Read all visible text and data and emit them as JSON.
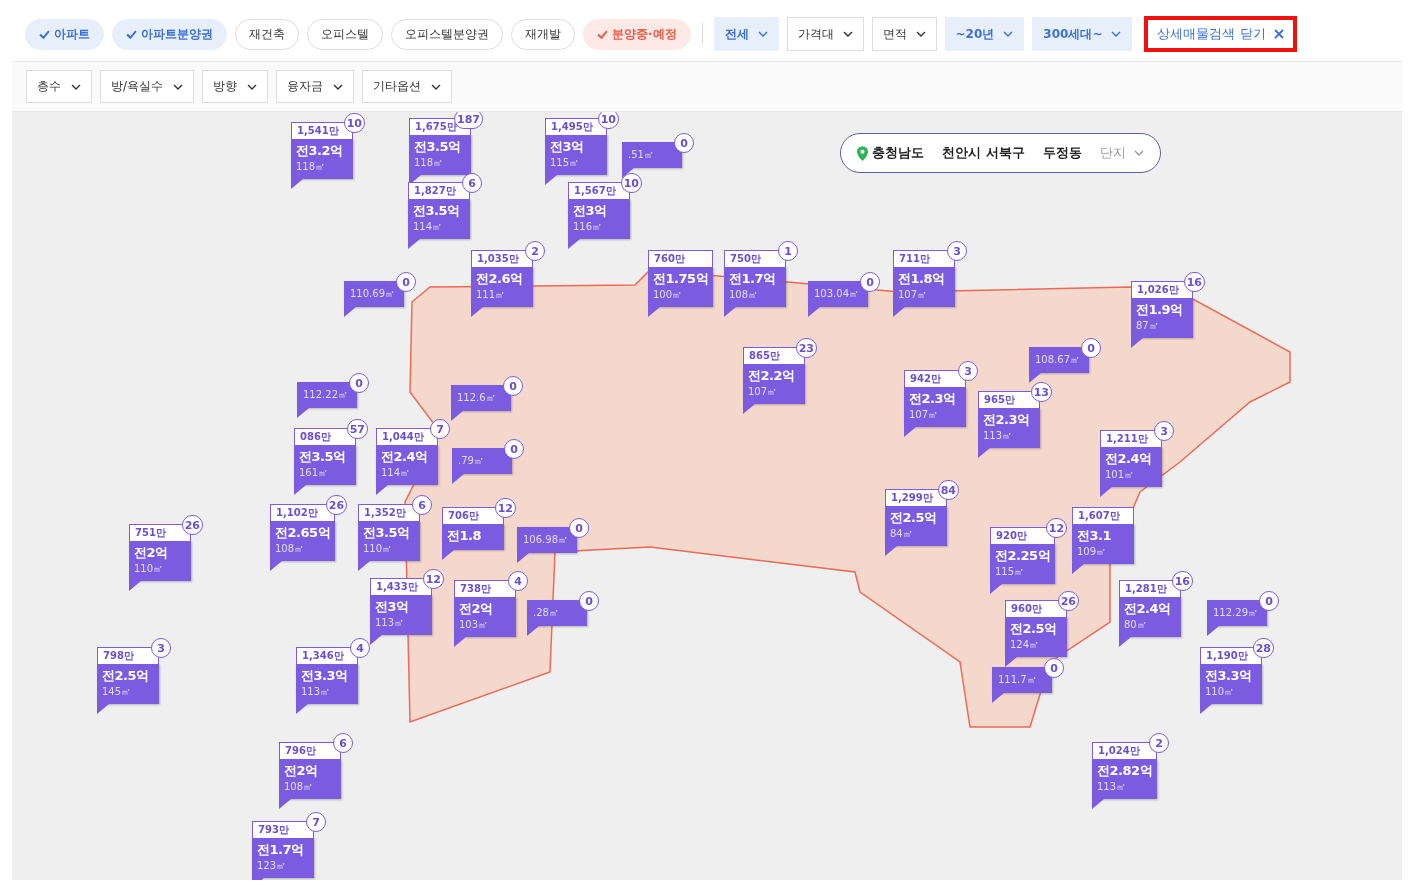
{
  "type_chips": [
    {
      "label": "아파트",
      "kind": "type",
      "selected": true
    },
    {
      "label": "아파트분양권",
      "kind": "type",
      "selected": true
    },
    {
      "label": "재건축",
      "kind": "type",
      "selected": false
    },
    {
      "label": "오피스텔",
      "kind": "type",
      "selected": false
    },
    {
      "label": "오피스텔분양권",
      "kind": "type",
      "selected": false
    },
    {
      "label": "재개발",
      "kind": "type",
      "selected": false
    },
    {
      "label": "분양중·예정",
      "kind": "presale",
      "selected": true
    }
  ],
  "filters": [
    {
      "label": "전세",
      "selected": true
    },
    {
      "label": "가격대",
      "selected": false
    },
    {
      "label": "면적",
      "selected": false
    },
    {
      "label": "~20년",
      "selected": true
    },
    {
      "label": "300세대~",
      "selected": true
    }
  ],
  "close_detail": {
    "label": "상세매물검색 닫기",
    "highlighted": true
  },
  "detail_filters": [
    {
      "label": "층수"
    },
    {
      "label": "방/욕실수"
    },
    {
      "label": "방향"
    },
    {
      "label": "융자금"
    },
    {
      "label": "기타옵션"
    }
  ],
  "breadcrumb": {
    "items": [
      "충청남도",
      "천안시 서북구",
      "두정동"
    ],
    "last": "단지"
  },
  "markers": [
    {
      "kind": "full",
      "unit_price": "1,541만",
      "price": "전3.2억",
      "area": "118㎡",
      "count": "10"
    },
    {
      "kind": "full",
      "unit_price": "1,675만",
      "price": "전3.5억",
      "area": "118㎡",
      "count": "187"
    },
    {
      "kind": "full",
      "unit_price": "1,495만",
      "price": "전3억",
      "area": "115㎡",
      "count": "10"
    },
    {
      "kind": "area",
      "area": ".51㎡",
      "count": "0"
    },
    {
      "kind": "full",
      "unit_price": "1,827만",
      "price": "전3.5억",
      "area": "114㎡",
      "count": "6"
    },
    {
      "kind": "full",
      "unit_price": "1,567만",
      "price": "전3억",
      "area": "116㎡",
      "count": "10"
    },
    {
      "kind": "area",
      "area": "110.69㎡",
      "count": "0"
    },
    {
      "kind": "full",
      "unit_price": "1,035만",
      "price": "전2.6억",
      "area": "111㎡",
      "count": "2"
    },
    {
      "kind": "full",
      "unit_price": "760만",
      "price": "전1.75억",
      "area": "100㎡"
    },
    {
      "kind": "full",
      "unit_price": "750만",
      "price": "전1.7억",
      "area": "108㎡",
      "count": "1"
    },
    {
      "kind": "area",
      "area": "103.04㎡",
      "count": "0"
    },
    {
      "kind": "full",
      "unit_price": "711만",
      "price": "전1.8억",
      "area": "107㎡",
      "count": "3"
    },
    {
      "kind": "full",
      "unit_price": "1,026만",
      "price": "전1.9억",
      "area": "87㎡",
      "count": "16"
    },
    {
      "kind": "full",
      "unit_price": "865만",
      "price": "전2.2억",
      "area": "107㎡",
      "count": "23"
    },
    {
      "kind": "area",
      "area": "108.67㎡",
      "count": "0"
    },
    {
      "kind": "area",
      "area": "112.22㎡",
      "count": "0"
    },
    {
      "kind": "area",
      "area": "112.6㎡",
      "count": "0"
    },
    {
      "kind": "full",
      "unit_price": "942만",
      "price": "전2.3억",
      "area": "107㎡",
      "count": "3"
    },
    {
      "kind": "full",
      "unit_price": "965만",
      "price": "전2.3억",
      "area": "113㎡",
      "count": "13"
    },
    {
      "kind": "full",
      "unit_price": "086만",
      "price": "전3.5억",
      "area": "161㎡",
      "count": "57"
    },
    {
      "kind": "full",
      "unit_price": "1,044만",
      "price": "전2.4억",
      "area": "114㎡",
      "count": "7"
    },
    {
      "kind": "area",
      "area": ".79㎡",
      "count": "0"
    },
    {
      "kind": "full",
      "unit_price": "1,211만",
      "price": "전2.4억",
      "area": "101㎡",
      "count": "3"
    },
    {
      "kind": "full",
      "unit_price": "751만",
      "price": "전2억",
      "area": "110㎡",
      "count": "26"
    },
    {
      "kind": "full",
      "unit_price": "1,102만",
      "price": "전2.65억",
      "area": "108㎡",
      "count": "26"
    },
    {
      "kind": "full",
      "unit_price": "1,352만",
      "price": "전3.5억",
      "area": "110㎡",
      "count": "6"
    },
    {
      "kind": "full",
      "unit_price": "706만",
      "price": "전1.8",
      "count": "12"
    },
    {
      "kind": "area",
      "area": "106.98㎡",
      "count": "0"
    },
    {
      "kind": "full",
      "unit_price": "1,299만",
      "price": "전2.5억",
      "area": "84㎡",
      "count": "84"
    },
    {
      "kind": "full",
      "unit_price": "920만",
      "price": "전2.25억",
      "area": "115㎡",
      "count": "12"
    },
    {
      "kind": "full",
      "unit_price": "1,607만",
      "price": "전3.1",
      "area": "109㎡"
    },
    {
      "kind": "full",
      "unit_price": "1,433만",
      "price": "전3억",
      "area": "113㎡",
      "count": "12"
    },
    {
      "kind": "full",
      "unit_price": "738만",
      "price": "전2억",
      "area": "103㎡",
      "count": "4"
    },
    {
      "kind": "area",
      "area": ".28㎡",
      "count": "0"
    },
    {
      "kind": "full",
      "unit_price": "960만",
      "price": "전2.5억",
      "area": "124㎡",
      "count": "26"
    },
    {
      "kind": "full",
      "unit_price": "1,281만",
      "price": "전2.4억",
      "area": "80㎡",
      "count": "16"
    },
    {
      "kind": "area",
      "area": "112.29㎡",
      "count": "0"
    },
    {
      "kind": "full",
      "unit_price": "798만",
      "price": "전2.5억",
      "area": "145㎡",
      "count": "3"
    },
    {
      "kind": "full",
      "unit_price": "1,346만",
      "price": "전3.3억",
      "area": "113㎡",
      "count": "4"
    },
    {
      "kind": "area",
      "area": "111.7㎡",
      "count": "0"
    },
    {
      "kind": "full",
      "unit_price": "1,190만",
      "price": "전3.3억",
      "area": "110㎡",
      "count": "28"
    },
    {
      "kind": "full",
      "unit_price": "796만",
      "price": "전2억",
      "area": "108㎡",
      "count": "6"
    },
    {
      "kind": "full",
      "unit_price": "1,024만",
      "price": "전2.82억",
      "area": "113㎡",
      "count": "2"
    },
    {
      "kind": "full",
      "unit_price": "793만",
      "price": "전1.7억",
      "area": "123㎡",
      "count": "7"
    }
  ]
}
